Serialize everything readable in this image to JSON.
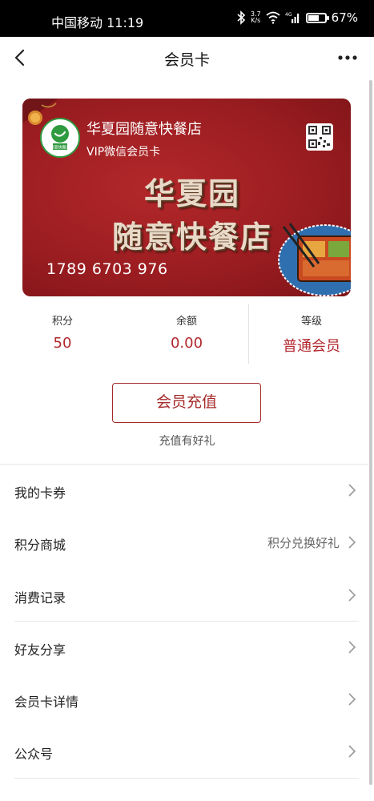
{
  "status_bar": {
    "carrier_time": "中国移动 11:19",
    "net_speed_value": "3.7",
    "net_speed_unit": "K/s",
    "network_type": "4G",
    "battery": "67%",
    "battery_level": 0.67
  },
  "nav": {
    "title": "会员卡"
  },
  "card": {
    "store_name": "华夏园随意快餐店",
    "card_type": "VIP微信会员卡",
    "big_title_line1": "华夏园",
    "big_title_line2": "随意快餐店",
    "card_number": "1789 6703 976",
    "logo_text": "随意快餐店"
  },
  "stats": {
    "points_label": "积分",
    "points_value": "50",
    "balance_label": "余额",
    "balance_value": "0.00",
    "level_label": "等级",
    "level_value": "普通会员"
  },
  "recharge": {
    "button_label": "会员充值",
    "tip": "充值有好礼"
  },
  "menu": [
    {
      "label": "我的卡券",
      "right": ""
    },
    {
      "label": "积分商城",
      "right": "积分兑换好礼"
    },
    {
      "label": "消费记录",
      "right": ""
    },
    {
      "label": "好友分享",
      "right": ""
    },
    {
      "label": "会员卡详情",
      "right": ""
    },
    {
      "label": "公众号",
      "right": ""
    }
  ],
  "colors": {
    "accent": "#b2282e",
    "card_bg": "#9b1d21"
  }
}
